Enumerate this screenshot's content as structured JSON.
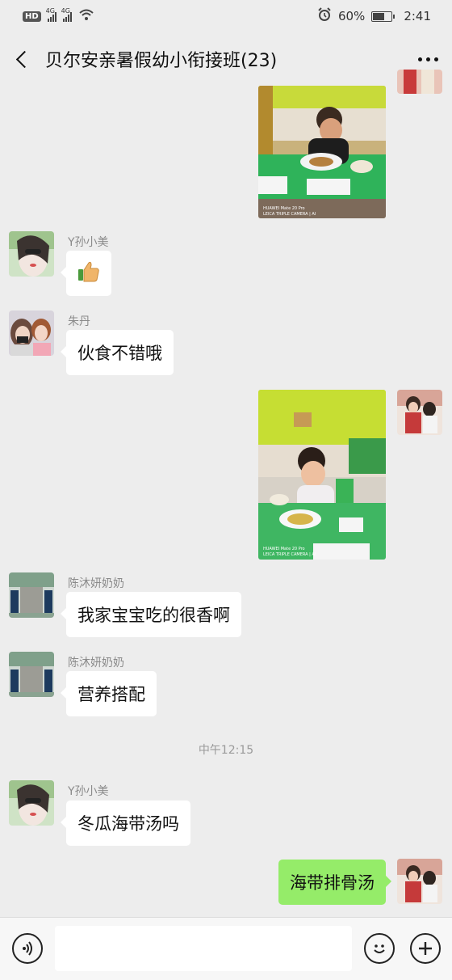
{
  "status_bar": {
    "hd": "HD",
    "net1": "4G",
    "net2": "4G",
    "battery": "60%",
    "battery_level": 0.6,
    "time": "2:41",
    "icons": [
      "hd-badge",
      "signal-icon",
      "signal-icon",
      "wifi-icon",
      "alarm-icon",
      "battery-icon"
    ]
  },
  "header": {
    "title": "贝尔安亲暑假幼小衔接班(23)",
    "back_icon": "chevron-left-icon",
    "more_icon": "more-dots-icon"
  },
  "messages": [
    {
      "side": "right",
      "type": "image",
      "image": "boy-eating-lunch-photo",
      "camera_watermark": "HUAWEI Mate 20 Pro\nLEICA TRIPLE CAMERA | AI"
    },
    {
      "side": "left",
      "sender": "Y孙小美",
      "type": "emoji",
      "emoji": "👍"
    },
    {
      "side": "left",
      "sender": "朱丹",
      "type": "text",
      "text": "伙食不错哦"
    },
    {
      "side": "right",
      "type": "image",
      "image": "girl-eating-lunch-photo",
      "camera_watermark": "HUAWEI Mate 20 Pro\nLEICA TRIPLE CAMERA | AI"
    },
    {
      "side": "left",
      "sender": "陈沐妍奶奶",
      "type": "text",
      "text": "我家宝宝吃的很香啊"
    },
    {
      "side": "left",
      "sender": "陈沐妍奶奶",
      "type": "text",
      "text": "营养搭配"
    },
    {
      "type": "time",
      "text": "中午12:15"
    },
    {
      "side": "left",
      "sender": "Y孙小美",
      "type": "text",
      "text": "冬瓜海带汤吗"
    },
    {
      "side": "right",
      "type": "text",
      "text": "海带排骨汤"
    }
  ],
  "input_bar": {
    "voice_icon": "voice-icon",
    "input_value": "",
    "emoji_icon": "smiley-icon",
    "plus_icon": "plus-icon"
  },
  "colors": {
    "background": "#ededed",
    "bubble_left": "#ffffff",
    "bubble_right": "#95ec69"
  }
}
